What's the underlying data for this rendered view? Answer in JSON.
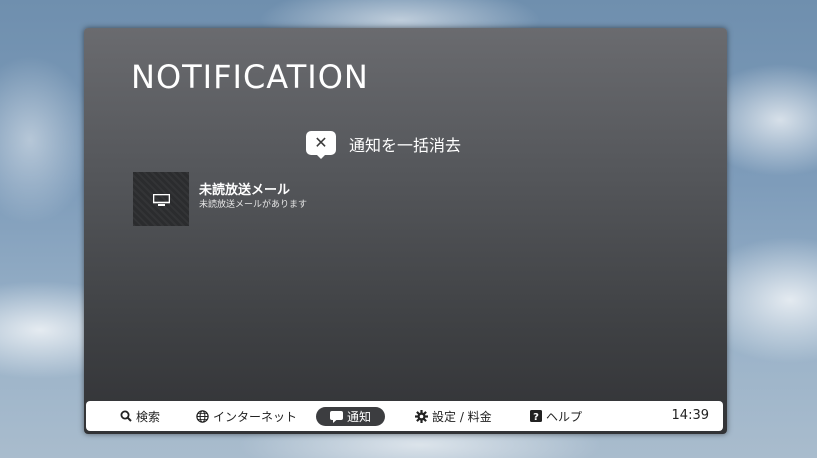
{
  "panel": {
    "title": "NOTIFICATION",
    "clear_all_label": "通知を一括消去"
  },
  "notifications": [
    {
      "icon": "tv-icon",
      "title": "未読放送メール",
      "subtitle": "未読放送メールがあります"
    }
  ],
  "bottom_nav": {
    "search": "検索",
    "internet": "インターネット",
    "notifications": "通知",
    "settings": "設定 / 料金",
    "help": "ヘルプ",
    "active_item": "通知",
    "clock": "14:39"
  },
  "colors": {
    "panel_top": "#6a6b6f",
    "panel_bottom": "#323336",
    "active_pill": "#3c3d40",
    "bar_background": "#ffffff"
  }
}
